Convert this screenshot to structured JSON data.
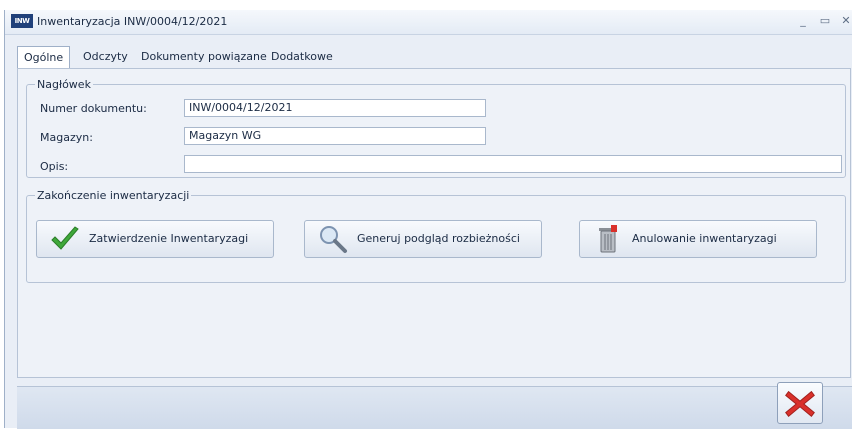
{
  "window": {
    "app_icon_text": "INW",
    "title": "Inwentaryzacja INW/0004/12/2021",
    "minimize_glyph": "_",
    "maximize_glyph": "▭",
    "close_glyph": "✕"
  },
  "tabs": [
    {
      "label": "Ogólne",
      "active": true
    },
    {
      "label": "Odczyty",
      "active": false
    },
    {
      "label": "Dokumenty powiązane",
      "active": false
    },
    {
      "label": "Dodatkowe",
      "active": false
    }
  ],
  "header_group": {
    "legend": "Nagłówek",
    "document_number_label": "Numer dokumentu:",
    "document_number_value": "INW/0004/12/2021",
    "warehouse_label": "Magazyn:",
    "warehouse_value": "Magazyn WG",
    "description_label": "Opis:",
    "description_value": ""
  },
  "finish_group": {
    "legend": "Zakończenie inwentaryzacji",
    "approve_label": "Zatwierdzenie Inwentaryzagi",
    "preview_label": "Generuj podgląd rozbieżności",
    "cancel_label": "Anulowanie inwentaryzagi"
  },
  "icons": {
    "approve": "check-icon",
    "preview": "magnifier-icon",
    "cancel": "trash-icon",
    "close": "red-x-icon"
  },
  "colors": {
    "check_green": "#3fa83a",
    "close_red": "#d9302b",
    "window_bg": "#e9eef6"
  }
}
